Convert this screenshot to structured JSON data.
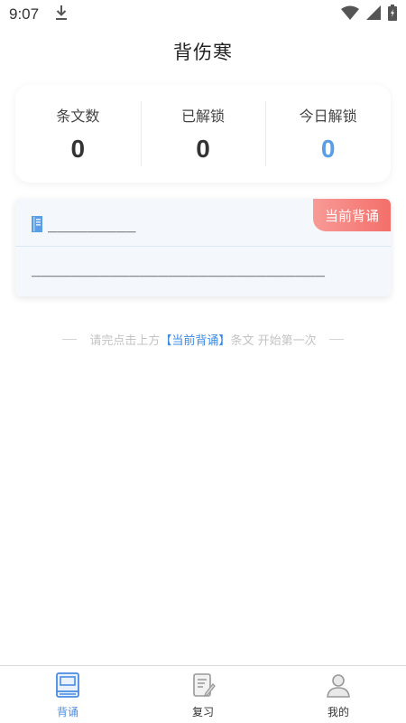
{
  "status_bar": {
    "time": "9:07",
    "icons": [
      "download-icon",
      "wifi-icon",
      "signal-icon",
      "battery-icon"
    ]
  },
  "header": {
    "title": "背伤寒"
  },
  "stats": [
    {
      "label": "条文数",
      "value": "0",
      "color": "#333333"
    },
    {
      "label": "已解锁",
      "value": "0",
      "color": "#333333"
    },
    {
      "label": "今日解锁",
      "value": "0",
      "color": "#5a9ee6"
    }
  ],
  "current_card": {
    "badge": "当前背诵",
    "line1": "_________",
    "line2": "______________________________"
  },
  "hint": {
    "before": "请完点击上方",
    "highlight": "【当前背诵】",
    "after": "条文 开始第一次"
  },
  "tabs": [
    {
      "label": "背诵",
      "icon": "book-icon",
      "active": true
    },
    {
      "label": "复习",
      "icon": "note-edit-icon",
      "active": false
    },
    {
      "label": "我的",
      "icon": "person-icon",
      "active": false
    }
  ],
  "colors": {
    "accent": "#4a8ce0",
    "badge": "#f46f6a",
    "card_bg": "#f4f8fd"
  }
}
